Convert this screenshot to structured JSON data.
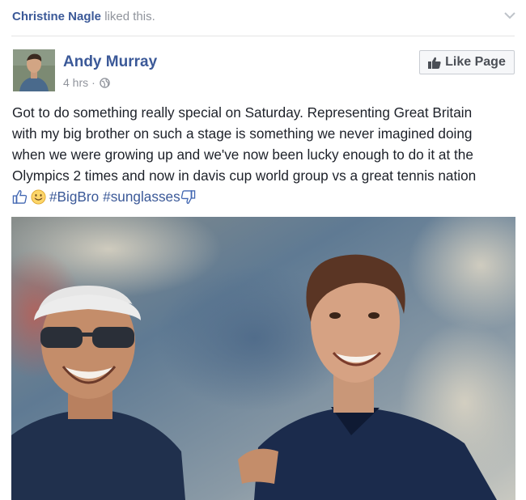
{
  "activity": {
    "actor": "Christine Nagle",
    "action": "liked this."
  },
  "post": {
    "author": "Andy Murray",
    "time": "4 hrs",
    "separator": "·",
    "privacy_icon": "globe-icon",
    "like_page_label": "Like Page",
    "text_lines": [
      "Got to do something really special on Saturday. Representing Great Britain",
      "with my big brother on such a stage is something we never imagined doing",
      "when we were growing up and we've now been lucky enough to do it at the",
      "Olympics 2 times and now in davis cup world group vs a great tennis nation"
    ],
    "hashtags": [
      "#BigBro",
      "#sunglasses"
    ],
    "emoticons": [
      "thumbs-up-icon",
      "smile-icon",
      "thumbs-down-icon"
    ]
  },
  "colors": {
    "link": "#3b5998",
    "meta": "#90949c",
    "text": "#1d2129"
  }
}
